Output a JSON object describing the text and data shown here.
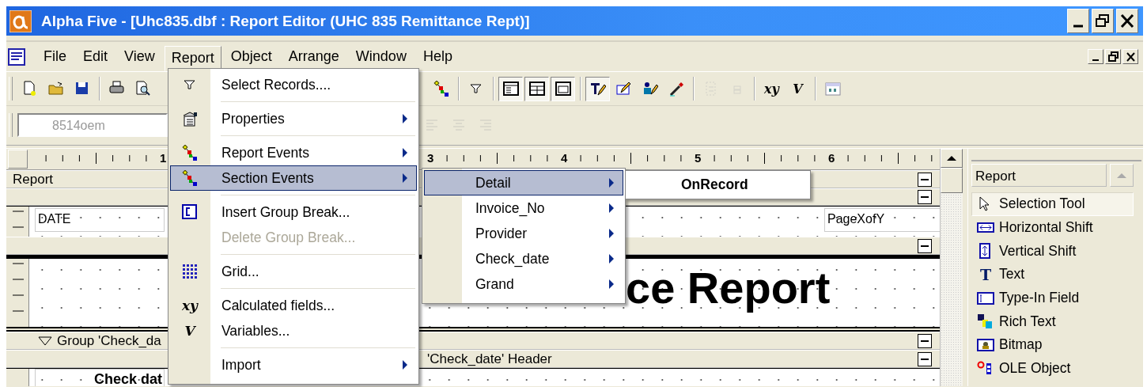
{
  "window": {
    "title": "Alpha Five - [Uhc835.dbf : Report Editor (UHC 835 Remittance Rept)]"
  },
  "menu_bar": {
    "items": [
      {
        "label": "File",
        "selected": false
      },
      {
        "label": "Edit",
        "selected": false
      },
      {
        "label": "View",
        "selected": false
      },
      {
        "label": "Report",
        "selected": true
      },
      {
        "label": "Object",
        "selected": false
      },
      {
        "label": "Arrange",
        "selected": false
      },
      {
        "label": "Window",
        "selected": false
      },
      {
        "label": "Help",
        "selected": false
      }
    ]
  },
  "toolbar": {
    "groups": [
      [
        {
          "kind": "icon",
          "pressed": false,
          "disabled": false
        },
        {
          "kind": "icon",
          "pressed": false,
          "disabled": false
        },
        {
          "kind": "icon",
          "pressed": false,
          "disabled": false
        }
      ],
      [
        {
          "kind": "icon",
          "pressed": false,
          "disabled": false
        },
        {
          "kind": "icon",
          "pressed": false,
          "disabled": false
        }
      ],
      [
        {
          "kind": "icon",
          "pressed": false,
          "disabled": false
        }
      ],
      [
        {
          "kind": "icon",
          "pressed": false,
          "disabled": false
        }
      ],
      [
        {
          "kind": "icon",
          "pressed": true,
          "disabled": false
        },
        {
          "kind": "icon",
          "pressed": true,
          "disabled": false
        },
        {
          "kind": "icon",
          "pressed": true,
          "disabled": false
        }
      ],
      [
        {
          "kind": "icon",
          "pressed": true,
          "disabled": false
        },
        {
          "kind": "icon",
          "pressed": false,
          "disabled": false
        },
        {
          "kind": "icon",
          "pressed": false,
          "disabled": false
        },
        {
          "kind": "icon",
          "pressed": false,
          "disabled": false
        }
      ],
      [
        {
          "kind": "icon",
          "pressed": false,
          "disabled": true
        },
        {
          "kind": "icon",
          "pressed": false,
          "disabled": true
        }
      ],
      [
        {
          "kind": "glyph",
          "label": "xy",
          "pressed": false,
          "disabled": false
        },
        {
          "kind": "glyph",
          "label": "V",
          "pressed": false,
          "disabled": false
        }
      ],
      [
        {
          "kind": "icon",
          "pressed": false,
          "disabled": false
        }
      ]
    ]
  },
  "format_bar": {
    "font_field": {
      "value": "8514oem",
      "disabled": true
    },
    "buttons": [
      {
        "disabled": true
      },
      {
        "disabled": true
      },
      {
        "disabled": true
      }
    ]
  },
  "ruler": {
    "labels": [
      "1",
      "3",
      "4",
      "5",
      "6"
    ]
  },
  "report": {
    "sections": [
      {
        "kind": "band",
        "label": "Report",
        "expanded": true
      },
      {
        "kind": "band",
        "expanded": true
      },
      {
        "kind": "area",
        "fields": [
          {
            "text": "DATE"
          },
          {
            "text": "PageXofY"
          }
        ]
      },
      {
        "kind": "band",
        "expanded": true
      },
      {
        "kind": "title_area",
        "title": "ce Report"
      },
      {
        "kind": "group_band",
        "label": "Group 'Check_da",
        "expanded": true
      },
      {
        "kind": "band",
        "label": "'Check_date' Header",
        "expanded": true
      },
      {
        "kind": "area",
        "fields": [
          {
            "text": "Check dat"
          }
        ]
      }
    ]
  },
  "report_menu": {
    "items": [
      {
        "kind": "item",
        "label": "Select Records....",
        "submenu": false,
        "selected": false,
        "disabled": false
      },
      {
        "kind": "separator"
      },
      {
        "kind": "item",
        "label": "Properties",
        "submenu": true,
        "selected": false,
        "disabled": false
      },
      {
        "kind": "separator"
      },
      {
        "kind": "item",
        "label": "Report Events",
        "submenu": true,
        "selected": false,
        "disabled": false
      },
      {
        "kind": "item",
        "label": "Section Events",
        "submenu": true,
        "selected": true,
        "disabled": false
      },
      {
        "kind": "separator"
      },
      {
        "kind": "item",
        "label": "Insert Group Break...",
        "submenu": false,
        "selected": false,
        "disabled": false
      },
      {
        "kind": "item",
        "label": "Delete Group Break...",
        "submenu": false,
        "selected": false,
        "disabled": true
      },
      {
        "kind": "separator"
      },
      {
        "kind": "item",
        "label": "Grid...",
        "submenu": false,
        "selected": false,
        "disabled": false
      },
      {
        "kind": "separator"
      },
      {
        "kind": "item",
        "label": "Calculated fields...",
        "glyph": "xy",
        "submenu": false,
        "selected": false,
        "disabled": false
      },
      {
        "kind": "item",
        "label": "Variables...",
        "glyph": "V",
        "submenu": false,
        "selected": false,
        "disabled": false
      },
      {
        "kind": "separator"
      },
      {
        "kind": "item",
        "label": "Import",
        "submenu": true,
        "selected": false,
        "disabled": false
      }
    ]
  },
  "section_events_menu": {
    "items": [
      {
        "label": "Detail",
        "submenu": true,
        "selected": true
      },
      {
        "label": "Invoice_No",
        "submenu": true,
        "selected": false
      },
      {
        "label": "Provider",
        "submenu": true,
        "selected": false
      },
      {
        "label": "Check_date",
        "submenu": true,
        "selected": false
      },
      {
        "label": "Grand",
        "submenu": true,
        "selected": false
      }
    ]
  },
  "detail_menu": {
    "items": [
      {
        "label": "OnRecord",
        "selected": false
      }
    ]
  },
  "toolbox": {
    "category": "Report",
    "items": [
      {
        "label": "Selection Tool",
        "selected": true
      },
      {
        "label": "Horizontal Shift",
        "selected": false
      },
      {
        "label": "Vertical Shift",
        "selected": false
      },
      {
        "label": "Text",
        "glyph": "T",
        "selected": false
      },
      {
        "label": "Type-In Field",
        "selected": false
      },
      {
        "label": "Rich Text",
        "selected": false
      },
      {
        "label": "Bitmap",
        "selected": false
      },
      {
        "label": "OLE Object",
        "selected": false
      }
    ]
  }
}
